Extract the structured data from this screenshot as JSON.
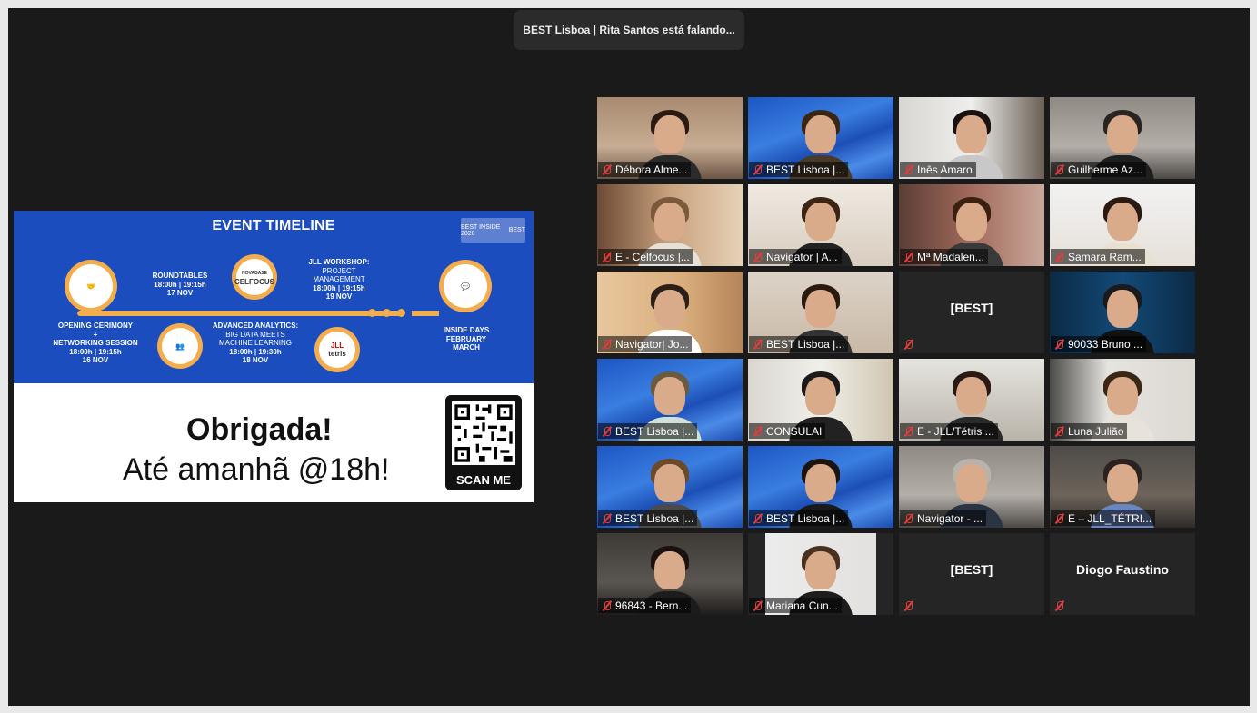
{
  "speaker_banner": "BEST Lisboa | Rita Santos está falando...",
  "slide": {
    "title": "EVENT TIMELINE",
    "logo_left": "BEST INSIDE 2020",
    "logo_right": "BEST",
    "events": {
      "opening": {
        "title": "OPENING CERIMONY\n+\nNETWORKING SESSION",
        "time": "18:00h | 19:15h",
        "date": "16 NOV"
      },
      "roundtables": {
        "title": "ROUNDTABLES",
        "time": "18:00h | 19:15h",
        "date": "17 NOV"
      },
      "analytics": {
        "title": "ADVANCED ANALYTICS:",
        "sub": "BIG DATA MEETS\nMACHINE LEARNING",
        "time": "18:00h | 19:30h",
        "date": "18 NOV"
      },
      "jll": {
        "title": "JLL WORKSHOP:",
        "sub": "PROJECT\nMANAGEMENT",
        "time": "18:00h | 19:15h",
        "date": "19 NOV"
      },
      "inside_days": {
        "title": "INSIDE DAYS",
        "sub": "FEBRUARY\nMARCH"
      }
    },
    "pins": {
      "celfocus_top": "NOVABASE",
      "celfocus": "CELFOCUS",
      "jll": "JLL",
      "tetris": "tetris"
    },
    "thanks": "Obrigada!",
    "see_you": "Até amanhã @18h!",
    "qr_label": "SCAN ME"
  },
  "participants": [
    {
      "name": "Débora Alme...",
      "style": "room"
    },
    {
      "name": "BEST Lisboa |...",
      "style": "best"
    },
    {
      "name": "Inês Amaro",
      "style": "shelf"
    },
    {
      "name": "Guilherme Az...",
      "style": "grey"
    },
    {
      "name": "E - Celfocus |...",
      "style": "warm"
    },
    {
      "name": "Navigator | A...",
      "style": "light"
    },
    {
      "name": "Mª Madalen...",
      "style": "books"
    },
    {
      "name": "Samara Ram...",
      "style": "white"
    },
    {
      "name": "Navigator| Jo...",
      "style": "wood"
    },
    {
      "name": "BEST Lisboa |...",
      "style": "beige"
    },
    {
      "name": "",
      "label": "[BEST]",
      "style": "empty"
    },
    {
      "name": "90033 Bruno ...",
      "style": "curtain"
    },
    {
      "name": "BEST Lisboa |...",
      "style": "best"
    },
    {
      "name": "CONSULAI",
      "style": "office"
    },
    {
      "name": "E - JLL/Tétris ...",
      "style": "office2"
    },
    {
      "name": "Luna Julião",
      "style": "wall"
    },
    {
      "name": "BEST Lisboa |...",
      "style": "best"
    },
    {
      "name": "BEST Lisboa |...",
      "style": "best"
    },
    {
      "name": "Navigator - ...",
      "style": "grey"
    },
    {
      "name": "E – JLL_TÉTRI...",
      "style": "dark"
    },
    {
      "name": "96843 - Bern...",
      "style": "darkroom"
    },
    {
      "name": "Mariana Cun...",
      "style": "whitewall"
    },
    {
      "name": "",
      "label": "[BEST]",
      "style": "empty"
    },
    {
      "name": "",
      "label": "Diogo Faustino",
      "style": "empty"
    }
  ],
  "colors": {
    "slide_blue": "#1b4dbf",
    "accent_orange": "#f4ad4d",
    "mute_red": "#e23d3d"
  }
}
